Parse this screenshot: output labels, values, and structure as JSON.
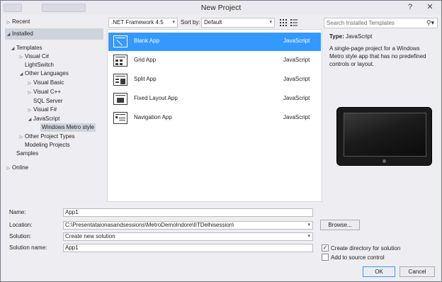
{
  "window": {
    "title": "New Project",
    "help_label": "?",
    "close_label": "✕"
  },
  "left": {
    "recent": "Recent",
    "installed": "Installed",
    "online": "Online",
    "tree": [
      {
        "label": "Templates",
        "expanded": true
      },
      {
        "label": "Visual C#"
      },
      {
        "label": "LightSwitch"
      },
      {
        "label": "Other Languages",
        "expanded": true
      },
      {
        "label": "Visual Basic"
      },
      {
        "label": "Visual C++"
      },
      {
        "label": "SQL Server"
      },
      {
        "label": "Visual F#"
      },
      {
        "label": "JavaScript",
        "expanded": true
      },
      {
        "label": "Windows Metro style",
        "selected": true
      },
      {
        "label": "Other Project Types"
      },
      {
        "label": "Modeling Projects"
      },
      {
        "label": "Samples"
      }
    ]
  },
  "toolbar": {
    "framework": ".NET Framework 4.5",
    "sort_label": "Sort by:",
    "sort_value": "Default"
  },
  "templates": [
    {
      "name": "Blank App",
      "language": "JavaScript",
      "selected": true
    },
    {
      "name": "Grid App",
      "language": "JavaScript"
    },
    {
      "name": "Split App",
      "language": "JavaScript"
    },
    {
      "name": "Fixed Layout App",
      "language": "JavaScript"
    },
    {
      "name": "Navigation App",
      "language": "JavaScript"
    }
  ],
  "details": {
    "search_placeholder": "Search Installed Templates",
    "type_label": "Type:",
    "type_value": "JavaScript",
    "description": "A single-page project for a Windows Metro style app that has no predefined controls or layout."
  },
  "form": {
    "name_label": "Name:",
    "name_value": "App1",
    "location_label": "Location:",
    "location_value": "C:\\Presentataionasandsessions\\MetroDemoIndore\\IITDelhisession\\",
    "browse_label": "Browse...",
    "solution_label": "Solution:",
    "solution_value": "Create new solution",
    "solution_name_label": "Solution name:",
    "solution_name_value": "App1",
    "create_directory_label": "Create directory for solution",
    "create_directory_checked": true,
    "add_source_control_label": "Add to source control",
    "add_source_control_checked": false,
    "ok_label": "OK",
    "cancel_label": "Cancel"
  },
  "icons": {
    "search": "search-icon",
    "dropdown": "chevron-down-icon",
    "grid_view": "grid-view-icon",
    "list_view": "list-view-icon"
  },
  "colors": {
    "selection": "#3399ff",
    "tree_selection": "#cfd4dc",
    "panel_bg": "#eeeef2"
  }
}
